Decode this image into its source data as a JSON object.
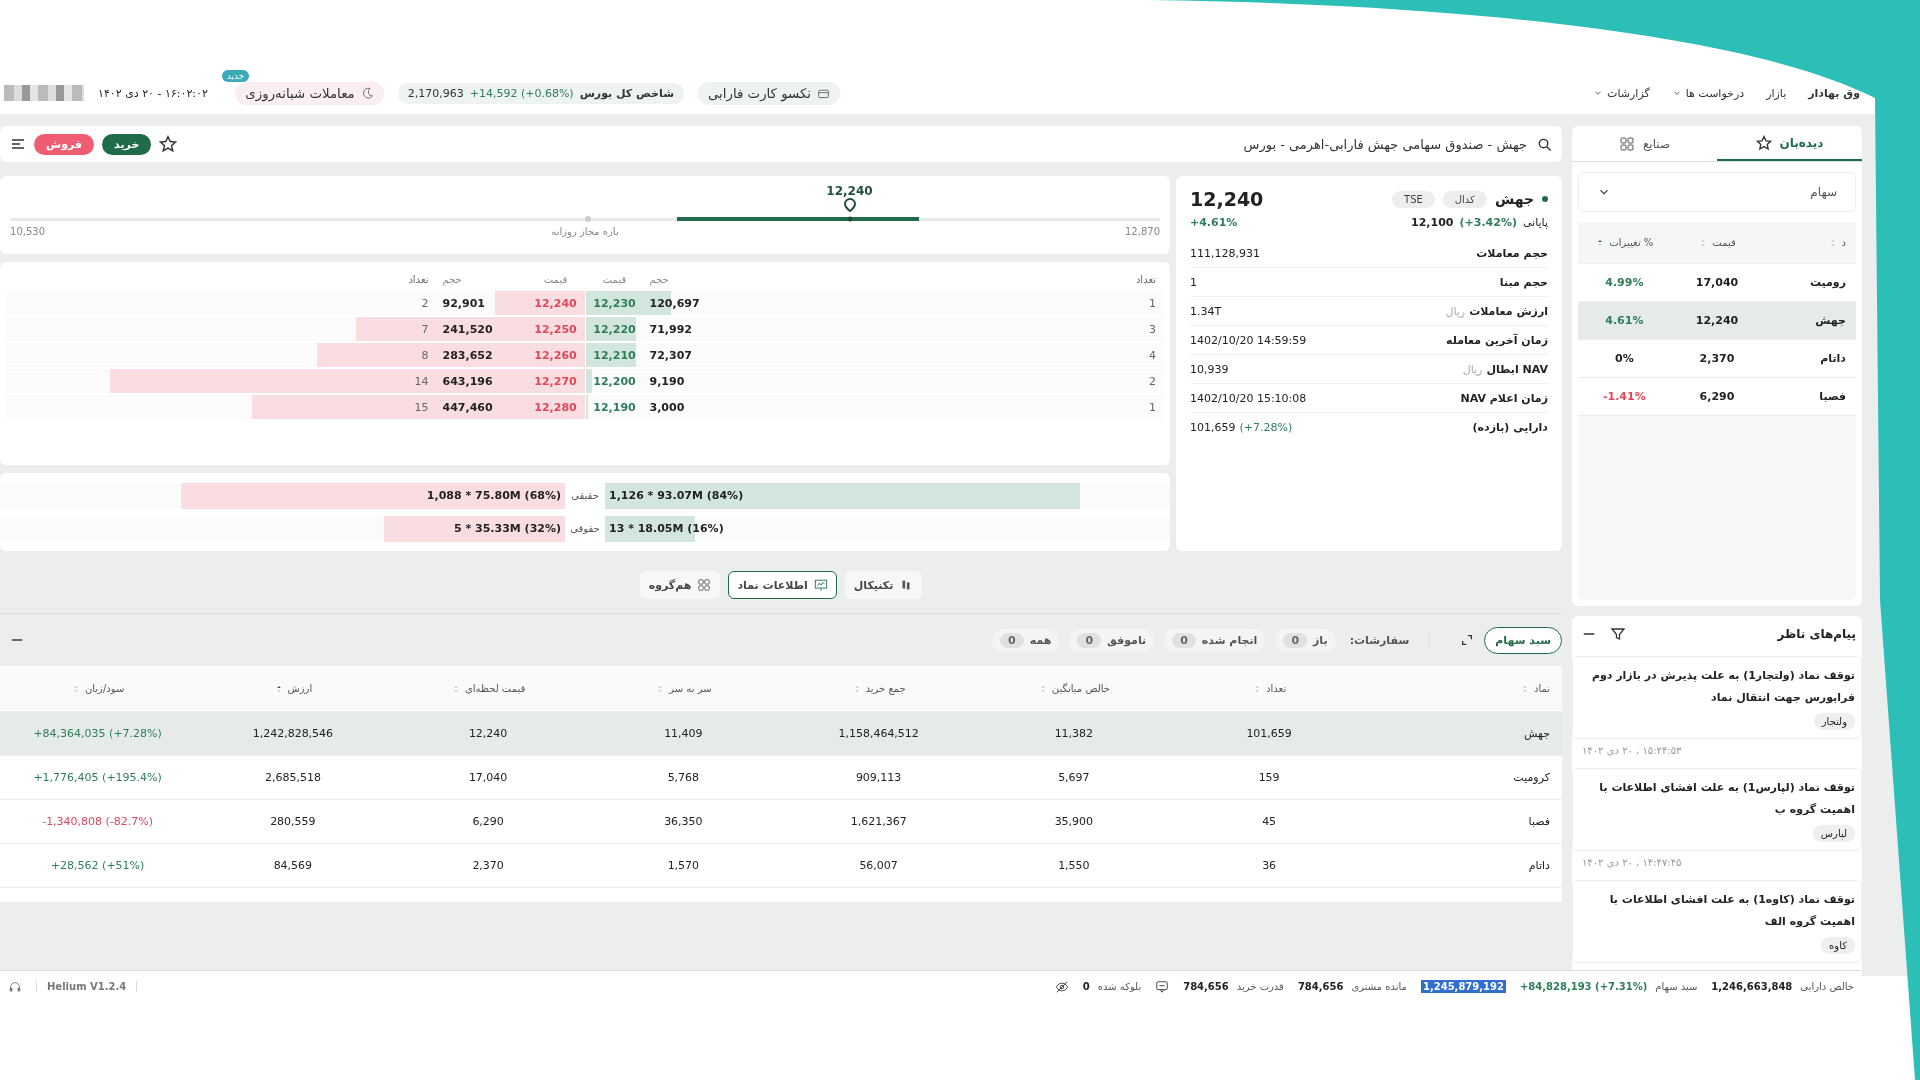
{
  "top_bar": {
    "menu": [
      {
        "label": "وق بهادار",
        "dropdown": false,
        "bold": true
      },
      {
        "label": "بازار",
        "dropdown": false,
        "bold": false
      },
      {
        "label": "درخواست ها",
        "dropdown": true,
        "bold": false
      },
      {
        "label": "گزارشات",
        "dropdown": true,
        "bold": false
      }
    ],
    "card_button": "نکسو کارت فارابی",
    "index": {
      "label": "شاخص کل بورس",
      "value": "2,170,963",
      "change": "+14,592 (+0.68%)"
    },
    "night_trading": {
      "label": "معاملات شبانه‌روزی",
      "badge": "جدید"
    },
    "datetime": "۱۶:۰۲:۰۲ - ۲۰ دی ۱۴۰۲"
  },
  "toolbar": {
    "search": {
      "value": "جهش - صندوق سهامی جهش فارابی-اهرمی - بورس"
    },
    "buy_button": "خرید",
    "sell_button": "فروش"
  },
  "price_range": {
    "current": "12,240",
    "min": "10,530",
    "max": "12,870",
    "label": "بازه مجاز روزانه",
    "level": 0.73
  },
  "order_book": {
    "buy_headers": [
      "تعداد",
      "حجم",
      "قیمت"
    ],
    "sell_headers": [
      "قیمت",
      "حجم",
      "تعداد"
    ],
    "rows": [
      {
        "buy_count": "1",
        "buy_volume": "120,697",
        "buy_price": "12,230",
        "buy": {
          "level": 0.148
        },
        "sell_price": "12,240",
        "sell_volume": "92,901",
        "sell_count": "2",
        "sell": {
          "level": 0.155
        }
      },
      {
        "buy_count": "3",
        "buy_volume": "71,992",
        "buy_price": "12,220",
        "buy": {
          "level": 0.088
        },
        "sell_price": "12,250",
        "sell_volume": "241,520",
        "sell_count": "7",
        "sell": {
          "level": 0.395
        }
      },
      {
        "buy_count": "4",
        "buy_volume": "72,307",
        "buy_price": "12,210",
        "buy": {
          "level": 0.088
        },
        "sell_price": "12,260",
        "sell_volume": "283,652",
        "sell_count": "8",
        "sell": {
          "level": 0.462
        }
      },
      {
        "buy_count": "2",
        "buy_volume": "9,190",
        "buy_price": "12,200",
        "buy": {
          "level": 0.012
        },
        "sell_price": "12,270",
        "sell_volume": "643,196",
        "sell_count": "14",
        "sell": {
          "level": 0.82
        }
      },
      {
        "buy_count": "1",
        "buy_volume": "3,000",
        "buy_price": "12,190",
        "buy": {
          "level": 0.004
        },
        "sell_price": "12,280",
        "sell_volume": "447,460",
        "sell_count": "15",
        "sell": {
          "level": 0.575
        }
      }
    ]
  },
  "investor_types": [
    {
      "label": "حقیقی",
      "buy_text": "1,126 * 93.07M (84%)",
      "buy": {
        "level": 0.84
      },
      "sell_text": "1,088 * 75.80M (68%)",
      "sell": {
        "level": 0.68
      }
    },
    {
      "label": "حقوقی",
      "buy_text": "13 * 18.05M (16%)",
      "buy": {
        "level": 0.16
      },
      "sell_text": "5 * 35.33M (32%)",
      "sell": {
        "level": 0.32
      }
    }
  ],
  "symbol_info": {
    "name": "جهش",
    "tags": [
      "کدال",
      "TSE"
    ],
    "price": "12,240",
    "change": "+4.61%",
    "closing_label": "پایانی",
    "closing_value": "12,100",
    "closing_change": "(+3.42%)",
    "rows": [
      {
        "label": "حجم معاملات",
        "value": "111,128,931"
      },
      {
        "label": "حجم مبنا",
        "value": "1"
      },
      {
        "label": "ارزش معاملات",
        "unit": "ریال",
        "value": "1.34T"
      },
      {
        "label": "زمان آخرین معامله",
        "value": "1402/10/20 14:59:59"
      },
      {
        "label": "NAV ابطال",
        "unit": "ریال",
        "value": "10,939"
      },
      {
        "label": "زمان اعلام NAV",
        "value": "1402/10/20 15:10:08"
      },
      {
        "label": "دارایی (بازده)",
        "value": "101,659",
        "extra": "(+7.28%)"
      }
    ]
  },
  "view_tabs": [
    {
      "label": "تکنیکال",
      "selected": false
    },
    {
      "label": "اطلاعات نماد",
      "selected": true
    },
    {
      "label": "هم‌گروه",
      "selected": false
    }
  ],
  "orders": {
    "basket_button": "سبد سهام",
    "label": "سفارشات:",
    "filters": [
      {
        "label": "باز",
        "count": "0"
      },
      {
        "label": "انجام شده",
        "count": "0"
      },
      {
        "label": "ناموفق",
        "count": "0"
      },
      {
        "label": "همه",
        "count": "0"
      }
    ]
  },
  "portfolio_table": {
    "columns": [
      {
        "label": "نماد",
        "sorted": false
      },
      {
        "label": "تعداد",
        "sorted": false
      },
      {
        "label": "خالص میانگین",
        "sorted": false
      },
      {
        "label": "جمع خرید",
        "sorted": false
      },
      {
        "label": "سر به سر",
        "sorted": false
      },
      {
        "label": "قیمت لحظه‌ای",
        "sorted": false
      },
      {
        "label": "ارزش",
        "sorted": true
      },
      {
        "label": "سود/زیان",
        "sorted": false
      }
    ],
    "rows": [
      {
        "selected": true,
        "kind": "gain",
        "cells": [
          "جهش",
          "101,659",
          "11,382",
          "1,158,464,512",
          "11,409",
          "12,240",
          "1,242,828,546",
          "+84,364,035 (+7.28%)"
        ]
      },
      {
        "selected": false,
        "kind": "gain",
        "cells": [
          "کرومیت",
          "159",
          "5,697",
          "909,113",
          "5,768",
          "17,040",
          "2,685,518",
          "+1,776,405 (+195.4%)"
        ]
      },
      {
        "selected": false,
        "kind": "loss",
        "cells": [
          "فصبا",
          "45",
          "35,900",
          "1,621,367",
          "36,350",
          "6,290",
          "280,559",
          "-1,340,808 (-82.7%)"
        ]
      },
      {
        "selected": false,
        "kind": "gain",
        "cells": [
          "داتام",
          "36",
          "1,550",
          "56,007",
          "1,570",
          "2,370",
          "84,569",
          "+28,562 (+51%)"
        ]
      }
    ]
  },
  "sidebar": {
    "tabs": [
      {
        "label": "دیده‌بان",
        "selected": true
      },
      {
        "label": "صنایع",
        "selected": false
      }
    ],
    "watchlist_select": "سهام",
    "watchlist": {
      "columns": [
        {
          "label": "د",
          "sorted": false
        },
        {
          "label": "قیمت",
          "sorted": false
        },
        {
          "label": "% تغییرات",
          "sorted": true
        }
      ],
      "rows": [
        {
          "name": "رومیت",
          "price": "17,040",
          "change": "4.99%",
          "kind": "gain",
          "selected": false
        },
        {
          "name": "جهش",
          "price": "12,240",
          "change": "4.61%",
          "kind": "gain",
          "selected": true
        },
        {
          "name": "داتام",
          "price": "2,370",
          "change": "0%",
          "kind": "flat",
          "selected": false
        },
        {
          "name": "فصبا",
          "price": "6,290",
          "change": "-1.41%",
          "kind": "loss",
          "selected": false
        }
      ]
    },
    "messages": {
      "title": "پیام‌های ناظر",
      "items": [
        {
          "text": "توقف نماد (ولتجار1) به علت پذیرش در بازار دوم فرابورس جهت انتقال نماد",
          "tag": "ولتجار",
          "time": "۱۵:۲۴:۵۳ ، ۲۰ دی ۱۴۰۲"
        },
        {
          "text": "توقف نماد (لپارس1) به علت افشای اطلاعات با اهمیت گروه ب",
          "tag": "لپارس",
          "time": "۱۴:۴۷:۴۵ ، ۲۰ دی ۱۴۰۲"
        },
        {
          "text": "توقف نماد (کاوه1) به علت افشای اطلاعات با اهمیت گروه الف",
          "tag": "کاوه"
        }
      ]
    }
  },
  "status_bar": {
    "items": [
      {
        "label": "خالص دارایی",
        "value": "1,246,663,848",
        "kind": "plain"
      },
      {
        "label": "سبد سهام",
        "value": "+84,828,193 (+7.31%)",
        "kind": "up"
      },
      {
        "value": "1,245,879,192",
        "kind": "highlighted"
      },
      {
        "label": "مانده مشتری",
        "value": "784,656",
        "kind": "plain"
      },
      {
        "label": "قدرت خرید",
        "value": "784,656",
        "kind": "plain"
      },
      {
        "label": "بلوکه شده",
        "value": "0",
        "kind": "plain"
      }
    ],
    "version": "Helium V1.2.4"
  }
}
